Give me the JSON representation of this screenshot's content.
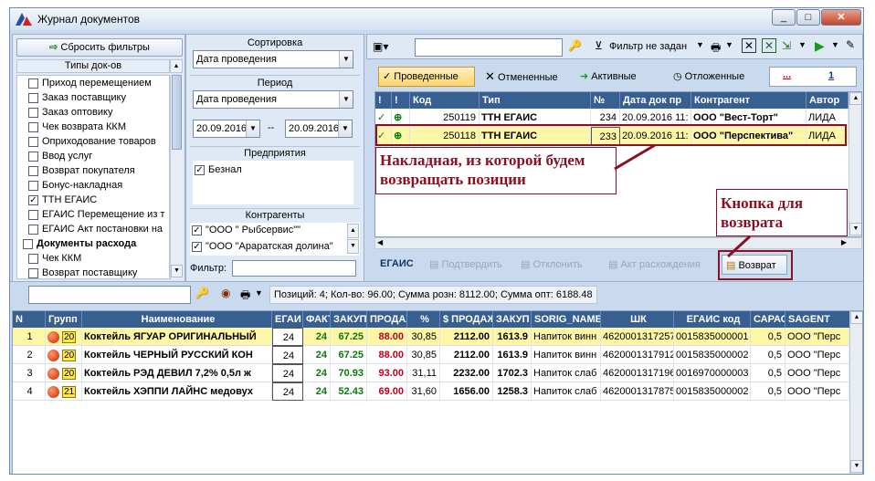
{
  "window": {
    "title": "Журнал документов",
    "min": "_",
    "max": "□",
    "close": "✕"
  },
  "filters": {
    "reset_label": "Сбросить фильтры",
    "types_header": "Типы док-ов",
    "types": [
      {
        "label": "Приход перемещением",
        "checked": false,
        "bold": false
      },
      {
        "label": "Заказ поставщику",
        "checked": false,
        "bold": false
      },
      {
        "label": "Заказ оптовику",
        "checked": false,
        "bold": false
      },
      {
        "label": "Чек возврата ККМ",
        "checked": false,
        "bold": false
      },
      {
        "label": "Оприходование товаров",
        "checked": false,
        "bold": false
      },
      {
        "label": "Ввод услуг",
        "checked": false,
        "bold": false
      },
      {
        "label": "Возврат покупателя",
        "checked": false,
        "bold": false
      },
      {
        "label": "Бонус-накладная",
        "checked": false,
        "bold": false
      },
      {
        "label": "ТТН ЕГАИС",
        "checked": true,
        "bold": false
      },
      {
        "label": "ЕГАИС Перемещение из т",
        "checked": false,
        "bold": false
      },
      {
        "label": "ЕГАИС Акт постановки на",
        "checked": false,
        "bold": false
      },
      {
        "label": "Документы расхода",
        "checked": false,
        "bold": true
      },
      {
        "label": "Чек ККМ",
        "checked": false,
        "bold": false
      },
      {
        "label": "Возврат поставщику",
        "checked": false,
        "bold": false
      }
    ],
    "sort_label": "Сортировка",
    "sort_value": "Дата проведения",
    "period_label": "Период",
    "period_field": "Дата проведения",
    "date_from": "20.09.2016",
    "date_sep": "--",
    "date_to": "20.09.2016",
    "enterprises_label": "Предприятия",
    "enterprise_item": "Безнал",
    "contractors_label": "Контрагенты",
    "contractors": [
      "\"ООО \" Рыбсервис\"\"",
      "\"ООО \"Араратская долина\""
    ],
    "filter_label": "Фильтр:"
  },
  "toolbar": {
    "filter_status": "Фильтр не задан"
  },
  "doc_tabs": {
    "posted": "Проведенные",
    "cancelled": "Отмененные",
    "active": "Активные",
    "postponed": "Отложенные",
    "btn_dots": "...",
    "btn_one": "1"
  },
  "doc_table": {
    "columns": [
      "!",
      "!",
      "Код",
      "Тип",
      "№",
      "Дата док пр",
      "Контрагент",
      "Автор"
    ],
    "rows": [
      {
        "code": "250119",
        "type": "ТТН ЕГАИС",
        "num": "234",
        "date": "20.09.2016 11:",
        "contractor": "ООО \"Вест-Торт\"",
        "author": "ЛИДА"
      },
      {
        "code": "250118",
        "type": "ТТН ЕГАИС",
        "num": "233",
        "date": "20.09.2016 11:",
        "contractor": "ООО \"Перспектива\"",
        "author": "ЛИДА"
      }
    ]
  },
  "annotations": {
    "invoice": "Накладная, из которой будем возвращать позиции",
    "return_button": "Кнопка для возврата"
  },
  "egais_bar": {
    "label": "ЕГАИС",
    "confirm": "Подтвердить",
    "reject": "Отклонить",
    "discrepancy": "Акт расхождения",
    "return": "Возврат"
  },
  "items": {
    "summary": "Позиций: 4; Кол-во: 96.00; Сумма розн: 8112.00; Сумма опт: 6188.48",
    "columns": [
      "N",
      "Групп",
      "Наименование",
      "ЕГАИ",
      "ФАКТ",
      "ЗАКУП",
      "ПРОДАЖ",
      "%",
      "$ ПРОДАЖ",
      "ЗАКУП",
      "SORIG_NAME",
      "ШК",
      "ЕГАИС код",
      "САРАС",
      "SAGENT"
    ],
    "rows": [
      {
        "n": "1",
        "grp": "20",
        "name": "Коктейль ЯГУАР ОРИГИНАЛЬНЫЙ",
        "egais": "24",
        "fact": "24",
        "buy": "67.25",
        "sell": "88.00",
        "pct": "30,85",
        "sum_sell": "2112.00",
        "sum_buy": "1613.9",
        "orig": "Напиток винн",
        "barcode": "4620001317257",
        "egais_code": "0015835000001",
        "cap": "0,5",
        "agent": "ООО \"Перс"
      },
      {
        "n": "2",
        "grp": "20",
        "name": "Коктейль ЧЕРНЫЙ РУССКИЙ КОН",
        "egais": "24",
        "fact": "24",
        "buy": "67.25",
        "sell": "88.00",
        "pct": "30,85",
        "sum_sell": "2112.00",
        "sum_buy": "1613.9",
        "orig": "Напиток винн",
        "barcode": "4620001317912",
        "egais_code": "0015835000002",
        "cap": "0,5",
        "agent": "ООО \"Перс"
      },
      {
        "n": "3",
        "grp": "20",
        "name": "Коктейль РЭД ДЕВИЛ 7,2% 0,5л ж",
        "egais": "24",
        "fact": "24",
        "buy": "70.93",
        "sell": "93.00",
        "pct": "31,11",
        "sum_sell": "2232.00",
        "sum_buy": "1702.3",
        "orig": "Напиток слаб",
        "barcode": "4620001317196",
        "egais_code": "0016970000003",
        "cap": "0,5",
        "agent": "ООО \"Перс"
      },
      {
        "n": "4",
        "grp": "21",
        "name": "Коктейль ХЭППИ ЛАЙНС медовух",
        "egais": "24",
        "fact": "24",
        "buy": "52.43",
        "sell": "69.00",
        "pct": "31,60",
        "sum_sell": "1656.00",
        "sum_buy": "1258.3",
        "orig": "Напиток слаб",
        "barcode": "4620001317875",
        "egais_code": "0015835000002",
        "cap": "0,5",
        "agent": "ООО \"Перс"
      }
    ]
  }
}
